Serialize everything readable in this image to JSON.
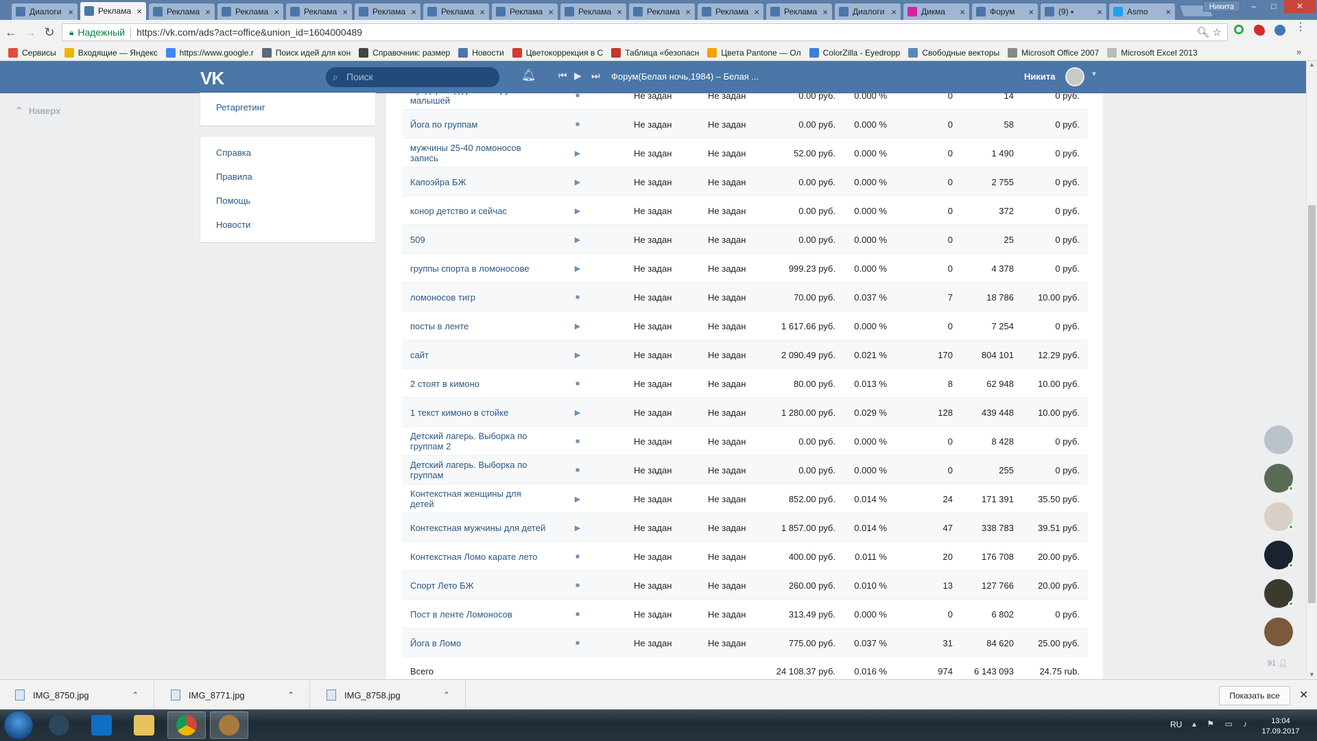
{
  "browser": {
    "tabs": [
      {
        "title": "Диалоги",
        "fav": "#4a76a8",
        "active": false
      },
      {
        "title": "Реклама",
        "fav": "#4a76a8",
        "active": true
      },
      {
        "title": "Реклама",
        "fav": "#4a76a8",
        "active": false
      },
      {
        "title": "Реклама",
        "fav": "#4a76a8",
        "active": false
      },
      {
        "title": "Реклама",
        "fav": "#4a76a8",
        "active": false
      },
      {
        "title": "Реклама",
        "fav": "#4a76a8",
        "active": false
      },
      {
        "title": "Реклама",
        "fav": "#4a76a8",
        "active": false
      },
      {
        "title": "Реклама",
        "fav": "#4a76a8",
        "active": false
      },
      {
        "title": "Реклама",
        "fav": "#4a76a8",
        "active": false
      },
      {
        "title": "Реклама",
        "fav": "#4a76a8",
        "active": false
      },
      {
        "title": "Реклама",
        "fav": "#4a76a8",
        "active": false
      },
      {
        "title": "Реклама",
        "fav": "#4a76a8",
        "active": false
      },
      {
        "title": "Диалоги",
        "fav": "#4a76a8",
        "active": false
      },
      {
        "title": "Дикма",
        "fav": "#d6249f",
        "active": false
      },
      {
        "title": "Форум",
        "fav": "#4a76a8",
        "active": false
      },
      {
        "title": "(9) ▪",
        "fav": "#4a76a8",
        "active": false
      },
      {
        "title": "Asmo",
        "fav": "#1da1f2",
        "active": false
      }
    ],
    "window_user": "Никита",
    "security_label": "Надежный",
    "url": "https://vk.com/ads?act=office&union_id=1604000489",
    "bookmarks": [
      {
        "label": "Сервисы",
        "color": "#e24c3f"
      },
      {
        "label": "Входящие — Яндекс",
        "color": "#f0b400"
      },
      {
        "label": "https://www.google.r",
        "color": "#4285f4"
      },
      {
        "label": "Поиск идей для кон",
        "color": "#5a6a7a"
      },
      {
        "label": "Справочник: размер",
        "color": "#444444"
      },
      {
        "label": "Новости",
        "color": "#4a76a8"
      },
      {
        "label": "Цветокоррекция в С",
        "color": "#d43a2f"
      },
      {
        "label": "Таблица «безопасн",
        "color": "#c0392b"
      },
      {
        "label": "Цвета Pantone — Ол",
        "color": "#f4a300"
      },
      {
        "label": "ColorZilla - Eyedropp",
        "color": "#3d7fd6"
      },
      {
        "label": "Свободные векторы",
        "color": "#5a88b8"
      },
      {
        "label": "Microsoft Office 2007",
        "color": "#888888"
      },
      {
        "label": "Microsoft Excel 2013",
        "color": "#bbbbbb"
      }
    ]
  },
  "vk": {
    "logo": "VK",
    "search_placeholder": "Поиск",
    "track": "Форум(Белая ночь,1984) – Белая ...",
    "user_name": "Никита"
  },
  "sidebar": {
    "to_top": "Наверх",
    "retargeting": "Ретаргетинг",
    "links": [
      "Справка",
      "Правила",
      "Помощь",
      "Новости"
    ]
  },
  "table": {
    "rows": [
      {
        "name": "Вундеркинд детские группы малышей",
        "status": "stop",
        "lim1": "Не задан",
        "lim2": "Не задан",
        "spent": "0.00 руб.",
        "ctr": "0.000 %",
        "clicks": "0",
        "impr": "14",
        "ecpc": "0 руб."
      },
      {
        "name": "Йога по группам",
        "status": "stop",
        "lim1": "Не задан",
        "lim2": "Не задан",
        "spent": "0.00 руб.",
        "ctr": "0.000 %",
        "clicks": "0",
        "impr": "58",
        "ecpc": "0 руб."
      },
      {
        "name": "мужчины 25-40 ломоносов запись",
        "status": "play",
        "lim1": "Не задан",
        "lim2": "Не задан",
        "spent": "52.00 руб.",
        "ctr": "0.000 %",
        "clicks": "0",
        "impr": "1 490",
        "ecpc": "0 руб."
      },
      {
        "name": "Капоэйра БЖ",
        "status": "play",
        "lim1": "Не задан",
        "lim2": "Не задан",
        "spent": "0.00 руб.",
        "ctr": "0.000 %",
        "clicks": "0",
        "impr": "2 755",
        "ecpc": "0 руб."
      },
      {
        "name": "конор детство и сейчас",
        "status": "play",
        "lim1": "Не задан",
        "lim2": "Не задан",
        "spent": "0.00 руб.",
        "ctr": "0.000 %",
        "clicks": "0",
        "impr": "372",
        "ecpc": "0 руб."
      },
      {
        "name": "509",
        "status": "play",
        "lim1": "Не задан",
        "lim2": "Не задан",
        "spent": "0.00 руб.",
        "ctr": "0.000 %",
        "clicks": "0",
        "impr": "25",
        "ecpc": "0 руб."
      },
      {
        "name": "группы спорта в ломоносове",
        "status": "play",
        "lim1": "Не задан",
        "lim2": "Не задан",
        "spent": "999.23 руб.",
        "ctr": "0.000 %",
        "clicks": "0",
        "impr": "4 378",
        "ecpc": "0 руб."
      },
      {
        "name": "ломоносов тигр",
        "status": "stop",
        "lim1": "Не задан",
        "lim2": "Не задан",
        "spent": "70.00 руб.",
        "ctr": "0.037 %",
        "clicks": "7",
        "impr": "18 786",
        "ecpc": "10.00 руб."
      },
      {
        "name": "посты в ленте",
        "status": "play",
        "lim1": "Не задан",
        "lim2": "Не задан",
        "spent": "1 617.66 руб.",
        "ctr": "0.000 %",
        "clicks": "0",
        "impr": "7 254",
        "ecpc": "0 руб."
      },
      {
        "name": "сайт",
        "status": "play",
        "lim1": "Не задан",
        "lim2": "Не задан",
        "spent": "2 090.49 руб.",
        "ctr": "0.021 %",
        "clicks": "170",
        "impr": "804 101",
        "ecpc": "12.29 руб."
      },
      {
        "name": "2 стоят в кимоно",
        "status": "stop",
        "lim1": "Не задан",
        "lim2": "Не задан",
        "spent": "80.00 руб.",
        "ctr": "0.013 %",
        "clicks": "8",
        "impr": "62 948",
        "ecpc": "10.00 руб."
      },
      {
        "name": "1 текст кимоно в стойке",
        "status": "play",
        "lim1": "Не задан",
        "lim2": "Не задан",
        "spent": "1 280.00 руб.",
        "ctr": "0.029 %",
        "clicks": "128",
        "impr": "439 448",
        "ecpc": "10.00 руб."
      },
      {
        "name": "Детский лагерь. Выборка по группам 2",
        "status": "stop",
        "lim1": "Не задан",
        "lim2": "Не задан",
        "spent": "0.00 руб.",
        "ctr": "0.000 %",
        "clicks": "0",
        "impr": "8 428",
        "ecpc": "0 руб."
      },
      {
        "name": "Детский лагерь. Выборка по группам",
        "status": "stop",
        "lim1": "Не задан",
        "lim2": "Не задан",
        "spent": "0.00 руб.",
        "ctr": "0.000 %",
        "clicks": "0",
        "impr": "255",
        "ecpc": "0 руб."
      },
      {
        "name": "Контекстная женщины для детей",
        "status": "play",
        "lim1": "Не задан",
        "lim2": "Не задан",
        "spent": "852.00 руб.",
        "ctr": "0.014 %",
        "clicks": "24",
        "impr": "171 391",
        "ecpc": "35.50 руб."
      },
      {
        "name": "Контекстная мужчины для детей",
        "status": "play",
        "lim1": "Не задан",
        "lim2": "Не задан",
        "spent": "1 857.00 руб.",
        "ctr": "0.014 %",
        "clicks": "47",
        "impr": "338 783",
        "ecpc": "39.51 руб."
      },
      {
        "name": "Контекстная Ломо карате лето",
        "status": "stop",
        "lim1": "Не задан",
        "lim2": "Не задан",
        "spent": "400.00 руб.",
        "ctr": "0.011 %",
        "clicks": "20",
        "impr": "176 708",
        "ecpc": "20.00 руб."
      },
      {
        "name": "Спорт Лето БЖ",
        "status": "stop",
        "lim1": "Не задан",
        "lim2": "Не задан",
        "spent": "260.00 руб.",
        "ctr": "0.010 %",
        "clicks": "13",
        "impr": "127 766",
        "ecpc": "20.00 руб."
      },
      {
        "name": "Пост в ленте Ломоносов",
        "status": "stop",
        "lim1": "Не задан",
        "lim2": "Не задан",
        "spent": "313.49 руб.",
        "ctr": "0.000 %",
        "clicks": "0",
        "impr": "6 802",
        "ecpc": "0 руб."
      },
      {
        "name": "Йога в Ломо",
        "status": "stop",
        "lim1": "Не задан",
        "lim2": "Не задан",
        "spent": "775.00 руб.",
        "ctr": "0.037 %",
        "clicks": "31",
        "impr": "84 620",
        "ecpc": "25.00 руб."
      }
    ],
    "total": {
      "label": "Всего",
      "spent": "24 108.37 руб.",
      "ctr": "0.016 %",
      "clicks": "974",
      "impr": "6 143 093",
      "ecpc": "24.75 rub."
    }
  },
  "chat": {
    "count": "91",
    "avatar_colors": [
      "#b9c3cc",
      "#5b6a55",
      "#d8d0c8",
      "#1a2230",
      "#3c3a2e",
      "#7a5a3a"
    ]
  },
  "downloads": {
    "files": [
      "IMG_8750.jpg",
      "IMG_8771.jpg",
      "IMG_8758.jpg"
    ],
    "show_all": "Показать все"
  },
  "taskbar": {
    "lang": "RU",
    "time": "13:04",
    "date": "17.09.2017"
  }
}
